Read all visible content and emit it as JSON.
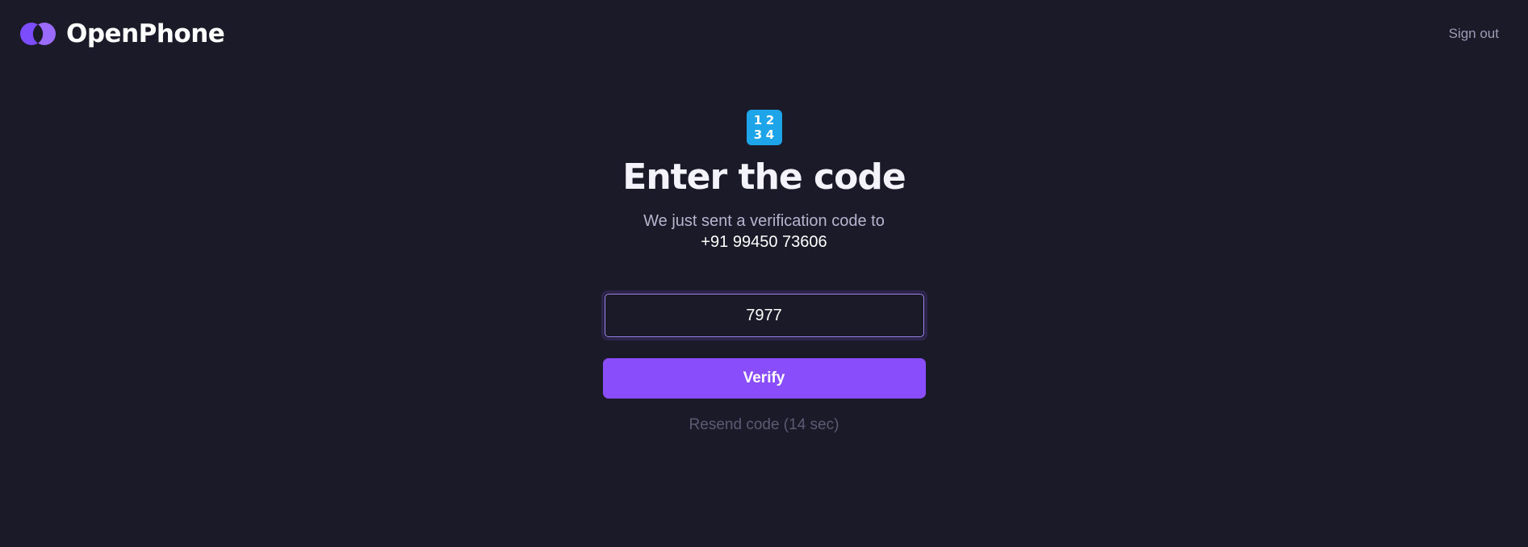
{
  "header": {
    "brand_name": "OpenPhone",
    "sign_out_label": "Sign out"
  },
  "colors": {
    "background": "#1b1a28",
    "accent": "#8a4dfb",
    "keycap": "#1ea4e8"
  },
  "icon": {
    "name": "keycap-digits-icon",
    "digits": [
      "1",
      "2",
      "3",
      "4"
    ]
  },
  "verify": {
    "title": "Enter the code",
    "subtitle": "We just sent a verification code to",
    "phone": "+91 99450 73606",
    "code_value": "7977",
    "button_label": "Verify",
    "resend_label": "Resend code (14 sec)"
  }
}
